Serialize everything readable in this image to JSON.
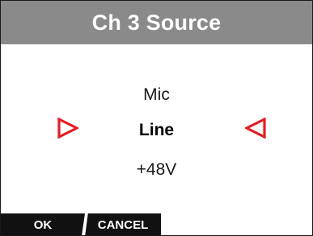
{
  "header": {
    "title": "Ch 3 Source"
  },
  "options": {
    "items": [
      "Mic",
      "Line",
      "+48V"
    ],
    "selected": "Line"
  },
  "icons": {
    "prev": "left-selection-arrow-icon",
    "next": "right-selection-arrow-icon"
  },
  "colors": {
    "title_bar": "#8a8a8a",
    "arrow_red": "#e31e24",
    "softkey_bg": "#111111"
  },
  "softkeys": {
    "ok_label": "OK",
    "cancel_label": "CANCEL"
  }
}
